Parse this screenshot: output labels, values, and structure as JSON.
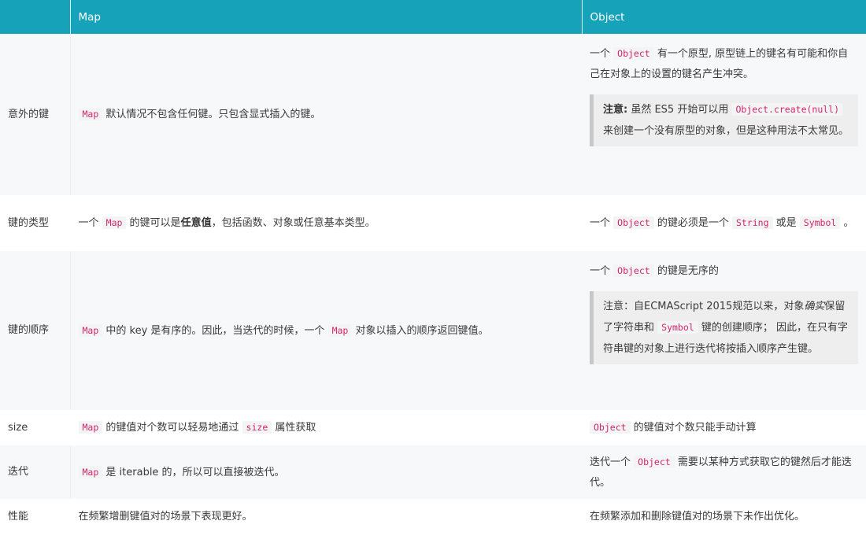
{
  "header": {
    "col1": "",
    "col2": "Map",
    "col3": "Object"
  },
  "rows": [
    {
      "key": "意外的键",
      "map": {
        "c1": "Map",
        "t1": " 默认情况不包含任何键。只包含显式插入的键。"
      },
      "obj": {
        "p1": "一个 ",
        "c1": "Object",
        "p2": " 有一个原型, 原型链上的键名有可能和你自己在对象上的设置的键名产生冲突。",
        "note_bold": "注意:",
        "note_t1": " 虽然 ES5 开始可以用 ",
        "note_code": "Object.create(null)",
        "note_t2": " 来创建一个没有原型的对象，但是这种用法不太常见。"
      }
    },
    {
      "key": "键的类型",
      "map": {
        "t1": "一个 ",
        "c1": "Map",
        "t2": " 的键可以是",
        "bold": "任意值",
        "t3": "，包括函数、对象或任意基本类型。"
      },
      "obj": {
        "t1": "一个 ",
        "c1": "Object",
        "t2": " 的键必须是一个 ",
        "c2": "String",
        "t3": " 或是 ",
        "c3": "Symbol",
        "t4": " 。"
      }
    },
    {
      "key": "键的顺序",
      "map": {
        "c1": "Map",
        "t1": " 中的 key 是有序的。因此，当迭代的时候，一个 ",
        "c2": "Map",
        "t2": " 对象以插入的顺序返回键值。"
      },
      "obj": {
        "t1": "一个 ",
        "c1": "Object",
        "t2": " 的键是无序的",
        "note_t1": "注意：自ECMAScript 2015规范以来，对象",
        "note_em": "确实",
        "note_t2": "保留了字符串和 ",
        "note_code": "Symbol",
        "note_t3": " 键的创建顺序； 因此，在只有字符串键的对象上进行迭代将按插入顺序产生键。"
      }
    },
    {
      "key": "size",
      "map": {
        "c1": "Map",
        "t1": " 的键值对个数可以轻易地通过 ",
        "c2": "size",
        "t2": " 属性获取"
      },
      "obj": {
        "c1": "Object",
        "t1": " 的键值对个数只能手动计算"
      }
    },
    {
      "key": "迭代",
      "map": {
        "c1": "Map",
        "t1": " 是 iterable 的，所以可以直接被迭代。"
      },
      "obj": {
        "t1": "迭代一个 ",
        "c1": "Object",
        "t2": " 需要以某种方式获取它的键然后才能迭代。"
      }
    },
    {
      "key": "性能",
      "map": {
        "t1": "在频繁增删键值对的场景下表现更好。"
      },
      "obj": {
        "t1": "在频繁添加和删除键值对的场景下未作出优化。"
      }
    }
  ]
}
